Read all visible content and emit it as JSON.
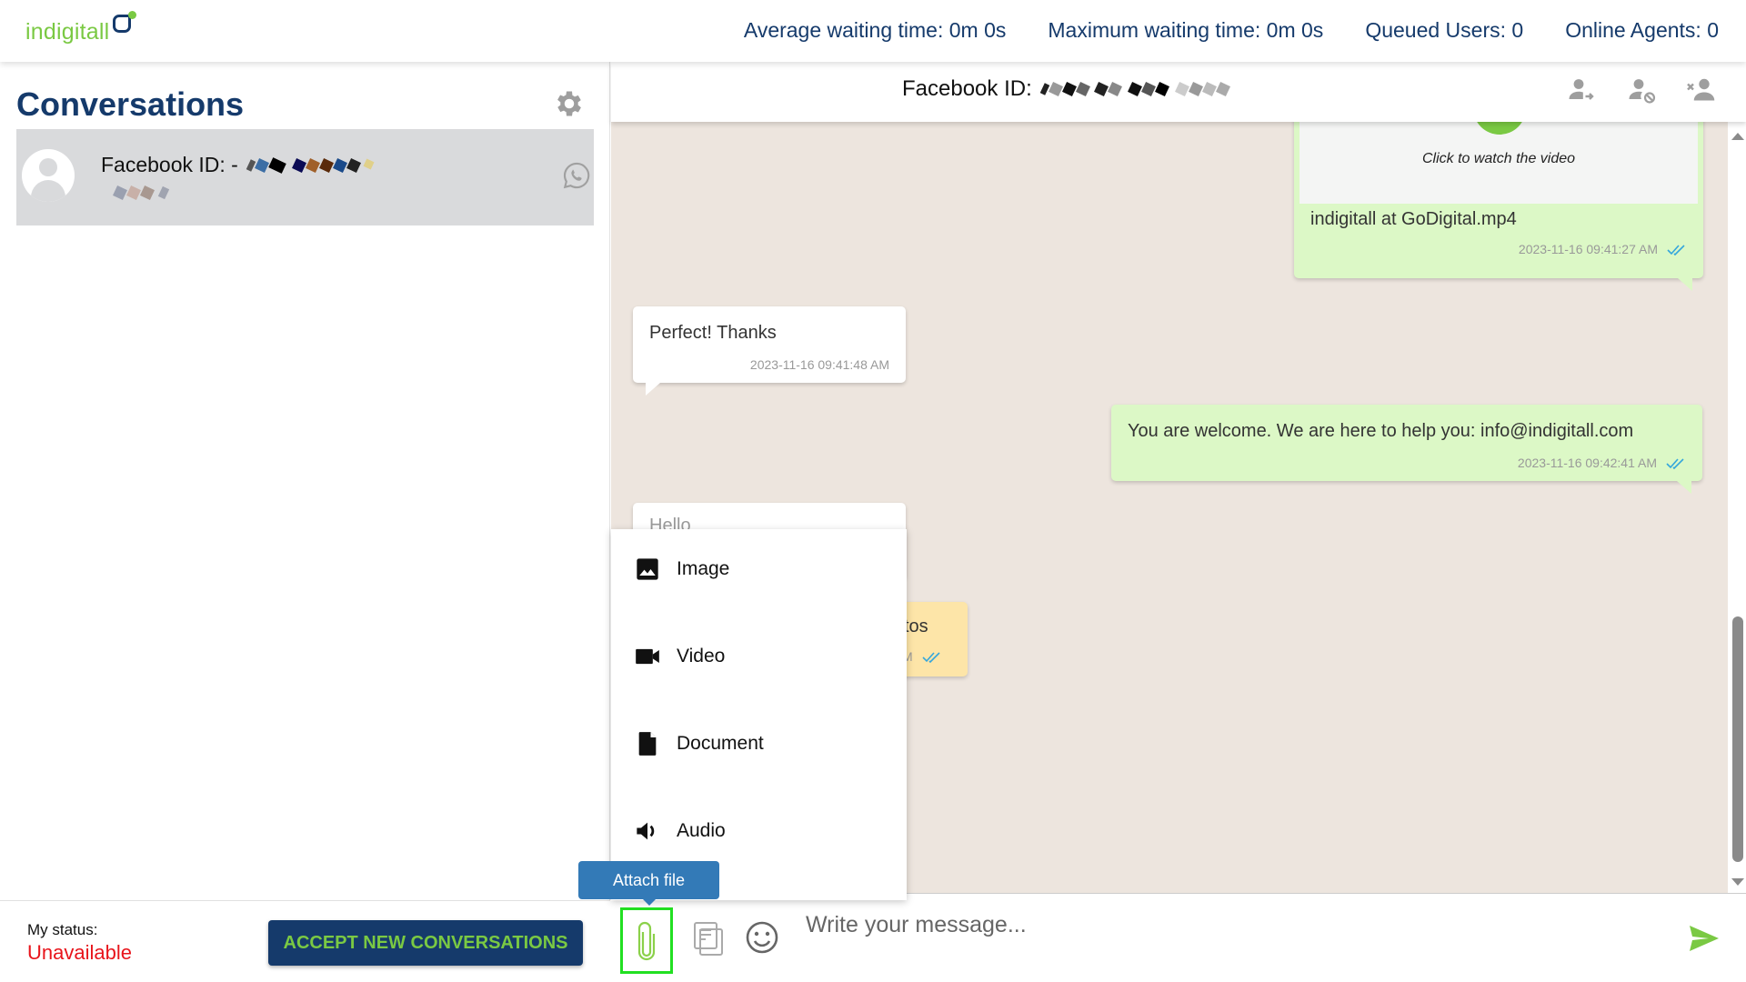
{
  "brand": {
    "name": "indigitall",
    "accent": "#7ac943",
    "navy": "#153a6b"
  },
  "stats": [
    {
      "label": "Average waiting time:",
      "value": "0m 0s"
    },
    {
      "label": "Maximum waiting time:",
      "value": "0m 0s"
    },
    {
      "label": "Queued Users:",
      "value": "0"
    },
    {
      "label": "Online Agents:",
      "value": "0"
    }
  ],
  "sidebar": {
    "title": "Conversations",
    "settings_icon": "gear-icon",
    "conversations": [
      {
        "name": "Facebook ID: -",
        "channel_icon": "whatsapp-icon",
        "selected": true
      }
    ]
  },
  "status": {
    "label": "My status:",
    "value": "Unavailable",
    "value_color": "#e8141b"
  },
  "accept_button": "ACCEPT NEW CONVERSATIONS",
  "chat": {
    "title": "Facebook ID:",
    "header_actions": [
      "transfer-user-icon",
      "block-user-icon",
      "close-conversation-icon"
    ],
    "messages": [
      {
        "direction": "out",
        "type": "video",
        "caption": "Click to watch the video",
        "text": "indigitall at GoDigital.mp4",
        "timestamp": "2023-11-16 09:41:27 AM",
        "read": true
      },
      {
        "direction": "in",
        "text": "Perfect! Thanks",
        "timestamp": "2023-11-16 09:41:48 AM"
      },
      {
        "direction": "out",
        "text": "You are welcome. We are here to help you: info@indigitall.com",
        "timestamp": "2023-11-16 09:42:41 AM",
        "read": true
      },
      {
        "direction": "in",
        "text": "Hello",
        "partial": true
      },
      {
        "direction": "out",
        "text": "tos",
        "timestamp": "M",
        "partial": true,
        "read": true
      }
    ]
  },
  "attach_menu": {
    "items": [
      {
        "label": "Image",
        "icon": "image-icon"
      },
      {
        "label": "Video",
        "icon": "video-camera-icon"
      },
      {
        "label": "Document",
        "icon": "document-icon"
      },
      {
        "label": "Audio",
        "icon": "speaker-icon"
      }
    ]
  },
  "composer": {
    "tooltip": "Attach file",
    "placeholder": "Write your message...",
    "value": ""
  }
}
